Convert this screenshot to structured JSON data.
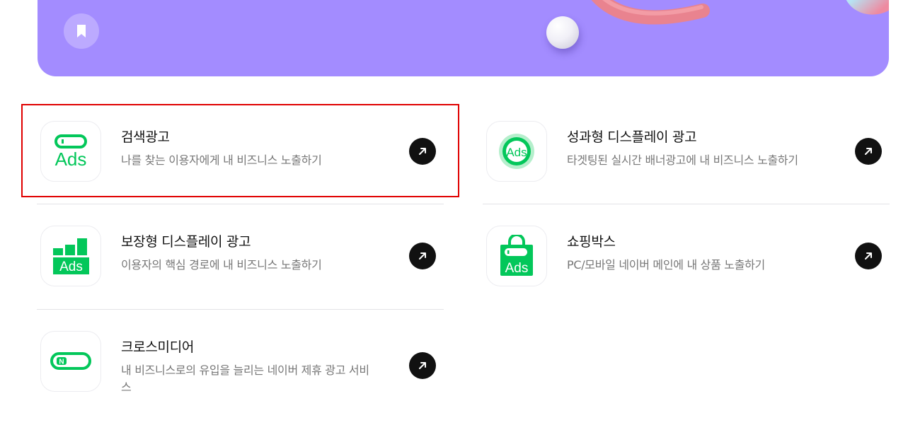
{
  "banner": {
    "bookmark_icon": "bookmark-icon",
    "background_color": "#a38cff"
  },
  "products": [
    {
      "title": "검색광고",
      "description": "나를 찾는 이용자에게 내 비즈니스 노출하기",
      "icon": "search-ads-icon",
      "icon_text": "Ads",
      "highlighted": true
    },
    {
      "title": "성과형 디스플레이 광고",
      "description": "타겟팅된 실시간 배너광고에 내 비즈니스 노출하기",
      "icon": "performance-display-ads-icon",
      "icon_text": "Ads"
    },
    {
      "title": "보장형 디스플레이 광고",
      "description": "이용자의 핵심 경로에 내 비즈니스 노출하기",
      "icon": "guaranteed-display-ads-icon",
      "icon_text": "Ads"
    },
    {
      "title": "쇼핑박스",
      "description": "PC/모바일 네이버 메인에 내 상품 노출하기",
      "icon": "shopping-box-icon",
      "icon_text": "Ads"
    },
    {
      "title": "크로스미디어",
      "description": "내 비즈니스로의 유입을 늘리는 네이버 제휴 광고 서비스",
      "icon": "cross-media-icon",
      "icon_text": "N"
    }
  ],
  "colors": {
    "brand_green": "#03c75a",
    "arrow_button": "#111111",
    "highlight": "#e00000"
  }
}
